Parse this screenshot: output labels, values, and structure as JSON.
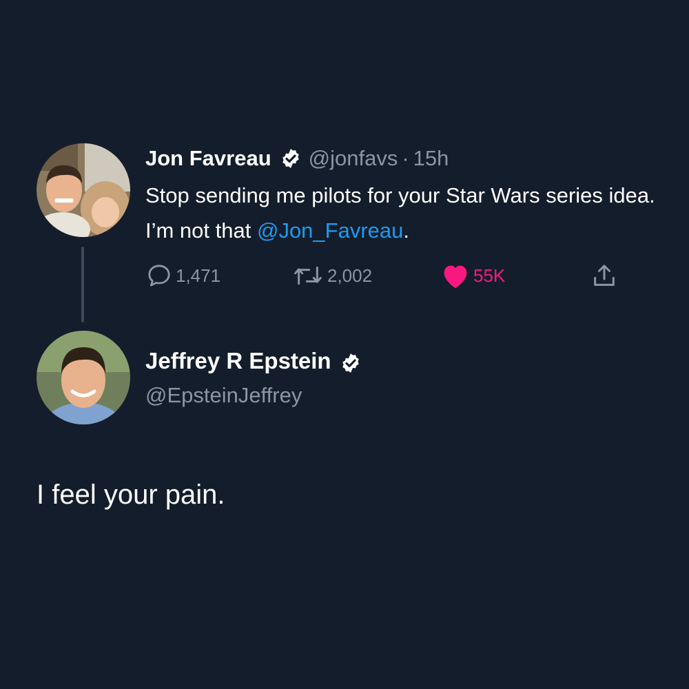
{
  "original_tweet": {
    "author_name": "Jon Favreau",
    "handle": "@jonfavs",
    "separator": "·",
    "time": "15h",
    "text_before_mention": "Stop sending me pilots for your Star Wars series idea. I’m not that ",
    "mention": "@Jon_Favreau",
    "text_after_mention": ".",
    "reply_count": "1,471",
    "retweet_count": "2,002",
    "like_count": "55K",
    "avatar_icon": "user-avatar-photo",
    "verified_icon": "verified-badge-icon"
  },
  "reply": {
    "author_name": "Jeffrey R Epstein",
    "handle": "@EpsteinJeffrey",
    "text": "I feel your pain.",
    "avatar_icon": "user-avatar-photo",
    "verified_icon": "verified-badge-icon"
  },
  "colors": {
    "background": "#141d2b",
    "secondary_text": "#8a96a3",
    "link": "#1d9bf0",
    "like": "#f91880"
  }
}
